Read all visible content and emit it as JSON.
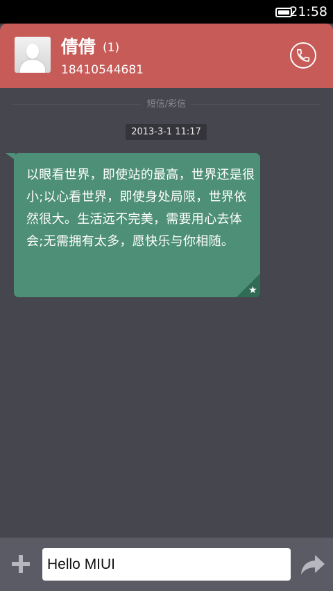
{
  "status_bar": {
    "time": "21:58",
    "battery_icon": "battery-icon"
  },
  "header": {
    "avatar_icon": "person-avatar-icon",
    "contact_name": "倩倩",
    "unread_count": "(1)",
    "phone_number": "18410544681",
    "call_icon": "phone-call-icon",
    "background_color": "#c65b58"
  },
  "conversation": {
    "channel_label": "短信/彩信",
    "timestamp": "2013-3-1 11:17",
    "messages": [
      {
        "text": "以眼看世界，即使站的最高，世界还是很小;以心看世界，即使身处局限，世界依然很大。生活远不完美，需要用心去体会;无需拥有太多，愿快乐与你相随。",
        "starred": true,
        "bubble_color": "#4e8f77"
      }
    ]
  },
  "compose": {
    "add_icon": "plus-icon",
    "input_value": "Hello MIUI",
    "send_icon": "send-arrow-icon"
  }
}
